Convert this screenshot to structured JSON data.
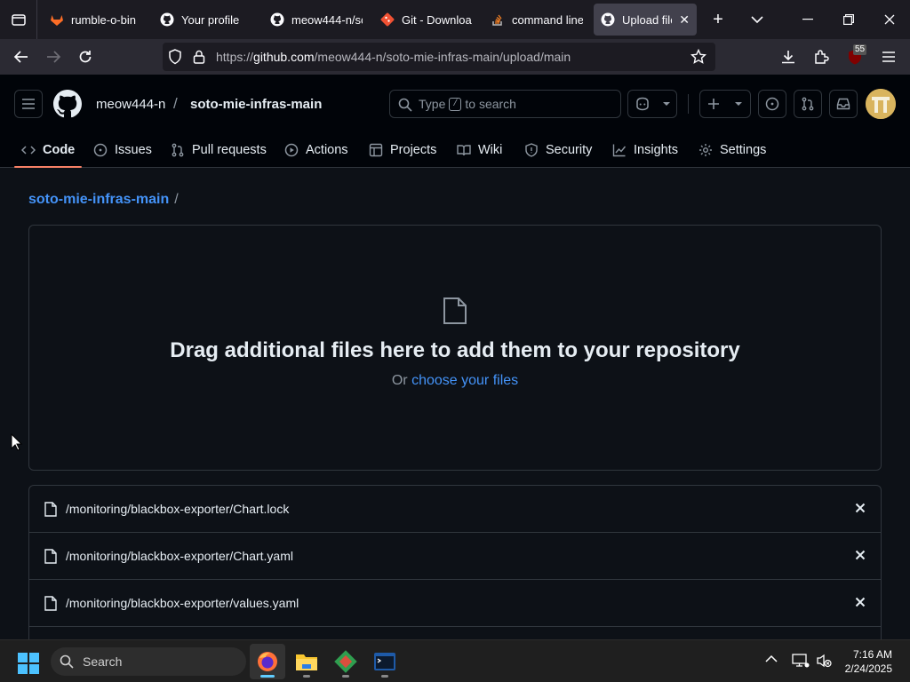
{
  "browser": {
    "tabs": [
      {
        "title": "rumble-o-bin",
        "icon": "gitlab-icon"
      },
      {
        "title": "Your profile",
        "icon": "github-icon"
      },
      {
        "title": "meow444-n/sc",
        "icon": "github-icon"
      },
      {
        "title": "Git - Downloa",
        "icon": "git-icon"
      },
      {
        "title": "command line",
        "icon": "stackoverflow-icon"
      },
      {
        "title": "Upload files",
        "icon": "github-icon",
        "active": true
      }
    ],
    "url_prefix": "https://",
    "url_domain": "github.com",
    "url_path": "/meow444-n/soto-mie-infras-main/upload/main",
    "extension_badge": "55"
  },
  "github": {
    "owner": "meow444-n",
    "separator": "/",
    "repo": "soto-mie-infras-main",
    "search_prefix": "Type",
    "search_key": "/",
    "search_suffix": "to search",
    "nav": [
      {
        "label": "Code",
        "icon": "code-icon",
        "active": true
      },
      {
        "label": "Issues",
        "icon": "issue-icon"
      },
      {
        "label": "Pull requests",
        "icon": "pull-request-icon"
      },
      {
        "label": "Actions",
        "icon": "play-icon"
      },
      {
        "label": "Projects",
        "icon": "table-icon"
      },
      {
        "label": "Wiki",
        "icon": "book-icon"
      },
      {
        "label": "Security",
        "icon": "shield-icon"
      },
      {
        "label": "Insights",
        "icon": "graph-icon"
      },
      {
        "label": "Settings",
        "icon": "gear-icon"
      }
    ]
  },
  "upload": {
    "breadcrumb_repo": "soto-mie-infras-main",
    "breadcrumb_sep": "/",
    "drop_title": "Drag additional files here to add them to your repository",
    "drop_or": "Or",
    "drop_link": "choose your files",
    "files": [
      "/monitoring/blackbox-exporter/Chart.lock",
      "/monitoring/blackbox-exporter/Chart.yaml",
      "/monitoring/blackbox-exporter/values.yaml"
    ]
  },
  "taskbar": {
    "search_label": "Search",
    "time": "7:16 AM",
    "date": "2/24/2025"
  },
  "colors": {
    "accent_link": "#4493f8",
    "active_tab_underline": "#f78166",
    "page_bg": "#0d1117"
  }
}
